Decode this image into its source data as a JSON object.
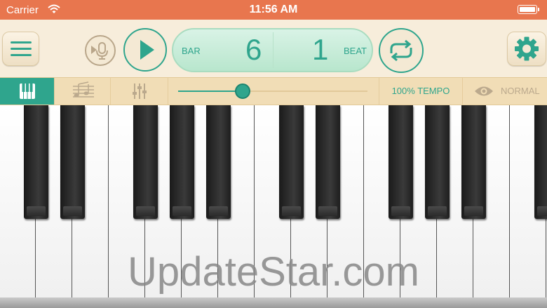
{
  "status_bar": {
    "carrier": "Carrier",
    "time": "11:56 AM",
    "background": "#e8764e"
  },
  "toolbar": {
    "menu_icon": "hamburger-menu-icon",
    "mic_icon": "play-microphone-icon",
    "play_icon": "play-icon",
    "counter": {
      "bar_label": "BAR",
      "bar_value": "6",
      "beat_value": "1",
      "beat_label": "BEAT"
    },
    "loop_icon": "loop-arrows-icon",
    "settings_icon": "gear-icon"
  },
  "secondary_bar": {
    "tabs": [
      {
        "name": "piano",
        "icon": "piano-keys-icon",
        "active": true
      },
      {
        "name": "score",
        "icon": "music-notes-icon",
        "active": false
      },
      {
        "name": "mixer",
        "icon": "mixer-sliders-icon",
        "active": false
      }
    ],
    "slider_value": 0.34,
    "tempo_label": "100% TEMPO",
    "mode_label": "NORMAL",
    "mode_icon": "eye-icon"
  },
  "colors": {
    "accent": "#2fa58d",
    "toolbar_bg": "#f7eddb",
    "secondary_bg": "#f1ddb6"
  },
  "watermark": "UpdateStar.com"
}
